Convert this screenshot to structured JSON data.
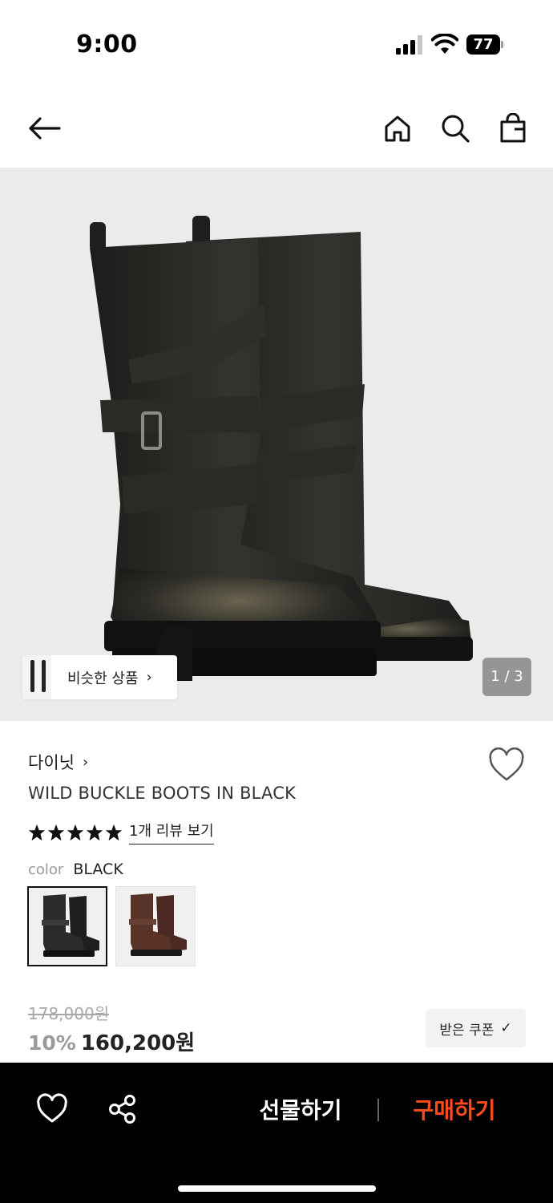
{
  "status_bar": {
    "time": "9:00",
    "battery": "77",
    "icons": [
      "signal-icon",
      "wifi-icon",
      "battery-icon"
    ]
  },
  "nav": {
    "icons": [
      "back-arrow-icon",
      "home-icon",
      "search-icon",
      "shopping-bag-icon"
    ]
  },
  "gallery": {
    "similar_label": "비슷한 상품",
    "similar_chevron": "›",
    "page_indicator": "1 / 3"
  },
  "product": {
    "brand": "다이닛",
    "brand_chevron": "›",
    "title": "WILD BUCKLE BOOTS IN BLACK",
    "rating": 5,
    "review_link": "1개 리뷰 보기",
    "color_label": "color",
    "color_value": "BLACK",
    "swatches": [
      {
        "name": "BLACK",
        "color": "#2b2b2b",
        "selected": true
      },
      {
        "name": "BROWN",
        "color": "#5a3328",
        "selected": false
      }
    ]
  },
  "price": {
    "original": "178,000원",
    "discount": "10%",
    "sale": "160,200원",
    "coupon_label": "받은 쿠폰",
    "coupon_check": "✓"
  },
  "bottom_bar": {
    "gift_label": "선물하기",
    "buy_label": "구매하기",
    "buy_color": "#ff4a1c",
    "icons": [
      "heart-icon",
      "share-icon"
    ]
  }
}
